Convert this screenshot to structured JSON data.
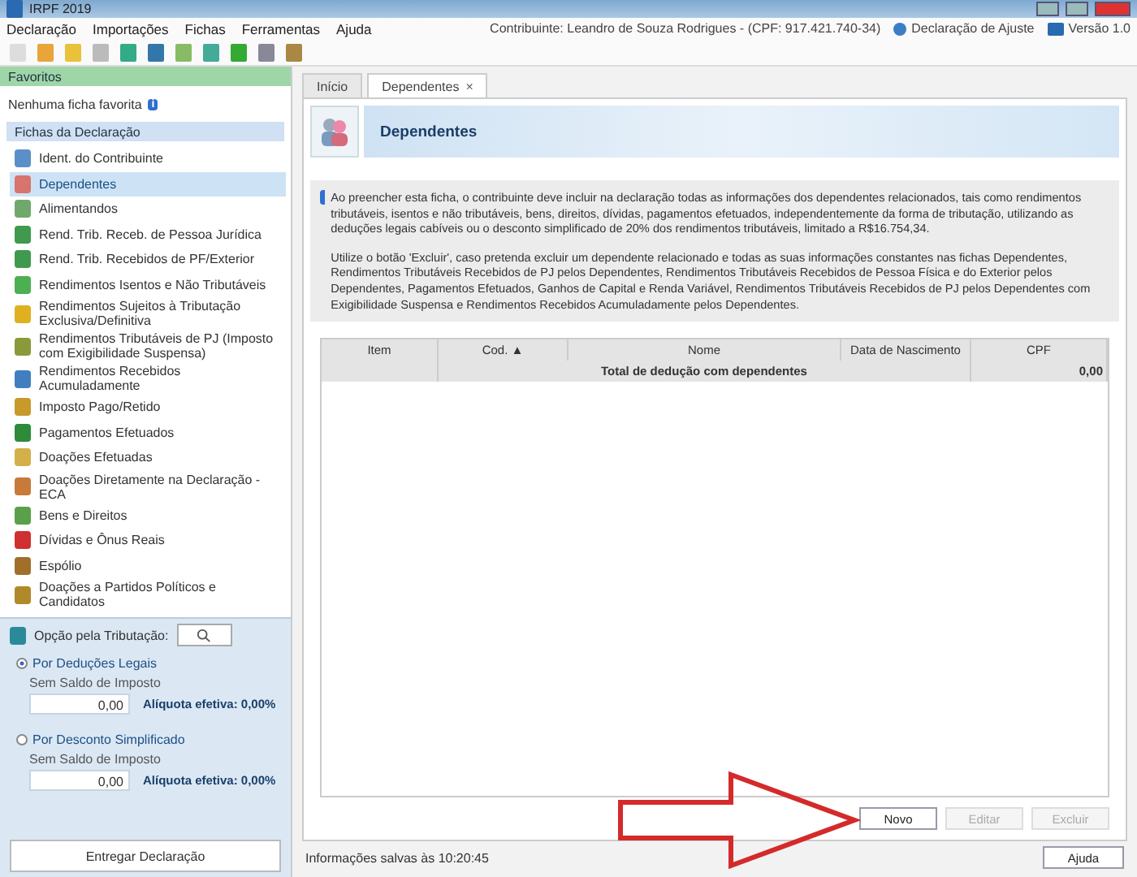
{
  "window": {
    "title": "IRPF 2019"
  },
  "menu": [
    "Declaração",
    "Importações",
    "Fichas",
    "Ferramentas",
    "Ajuda"
  ],
  "status_top": {
    "taxpayer": "Contribuinte: Leandro de Souza Rodrigues - (CPF: 917.421.740-34)",
    "declaration": "Declaração de Ajuste",
    "version": "Versão 1.0"
  },
  "favorites": {
    "title": "Favoritos",
    "empty": "Nenhuma ficha favorita",
    "badge": "i"
  },
  "forms": {
    "title": "Fichas da Declaração",
    "items": [
      {
        "label": "Ident. do Contribuinte",
        "selected": false,
        "color": "#5b8fc9"
      },
      {
        "label": "Dependentes",
        "selected": true,
        "color": "#d9736d"
      },
      {
        "label": "Alimentandos",
        "selected": false,
        "color": "#6fa86a"
      },
      {
        "label": "Rend. Trib. Receb. de Pessoa Jurídica",
        "selected": false,
        "color": "#3f9a4e"
      },
      {
        "label": "Rend. Trib. Recebidos de PF/Exterior",
        "selected": false,
        "color": "#3f9a4e"
      },
      {
        "label": "Rendimentos Isentos e Não Tributáveis",
        "selected": false,
        "color": "#4caf50"
      },
      {
        "label": "Rendimentos Sujeitos à Tributação Exclusiva/Definitiva",
        "selected": false,
        "color": "#e0b020"
      },
      {
        "label": "Rendimentos Tributáveis de PJ (Imposto com Exigibilidade Suspensa)",
        "selected": false,
        "color": "#8a9a3a"
      },
      {
        "label": "Rendimentos Recebidos Acumuladamente",
        "selected": false,
        "color": "#3f7fbf"
      },
      {
        "label": "Imposto Pago/Retido",
        "selected": false,
        "color": "#c89a2a"
      },
      {
        "label": "Pagamentos Efetuados",
        "selected": false,
        "color": "#2e8b3a"
      },
      {
        "label": "Doações Efetuadas",
        "selected": false,
        "color": "#d4b04a"
      },
      {
        "label": "Doações Diretamente na Declaração - ECA",
        "selected": false,
        "color": "#c87a3a"
      },
      {
        "label": "Bens e Direitos",
        "selected": false,
        "color": "#5aa04a"
      },
      {
        "label": "Dívidas e Ônus Reais",
        "selected": false,
        "color": "#d03030"
      },
      {
        "label": "Espólio",
        "selected": false,
        "color": "#a0702a"
      },
      {
        "label": "Doações a Partidos Políticos e Candidatos",
        "selected": false,
        "color": "#b08a2a"
      }
    ]
  },
  "taxation": {
    "title": "Opção pela Tributação:",
    "options": [
      {
        "label": "Por Deduções Legais",
        "selected": true,
        "caption": "Sem Saldo de Imposto",
        "value": "0,00",
        "rate": "Alíquota efetiva: 0,00%"
      },
      {
        "label": "Por Desconto Simplificado",
        "selected": false,
        "caption": "Sem Saldo de Imposto",
        "value": "0,00",
        "rate": "Alíquota efetiva: 0,00%"
      }
    ],
    "submit": "Entregar Declaração"
  },
  "tabs": [
    {
      "label": "Início",
      "selected": false,
      "closable": false
    },
    {
      "label": "Dependentes",
      "selected": true,
      "closable": true
    }
  ],
  "close_glyph": "×",
  "page": {
    "title": "Dependentes",
    "info": [
      "Ao preencher esta ficha, o contribuinte deve incluir na declaração todas as informações dos dependentes relacionados, tais como rendimentos tributáveis, isentos e não tributáveis, bens, direitos, dívidas, pagamentos efetuados, independentemente da forma de tributação, utilizando as deduções legais cabíveis ou o desconto simplificado de 20% dos rendimentos tributáveis, limitado a R$16.754,34.",
      "Utilize o botão 'Excluir', caso pretenda excluir um dependente relacionado e todas as suas informações constantes nas fichas Dependentes, Rendimentos Tributáveis Recebidos de PJ pelos Dependentes, Rendimentos Tributáveis Recebidos de Pessoa Física e do Exterior pelos Dependentes, Pagamentos Efetuados, Ganhos de Capital e Renda Variável, Rendimentos Tributáveis Recebidos de PJ pelos Dependentes com Exigibilidade Suspensa e Rendimentos Recebidos Acumuladamente pelos Dependentes."
    ],
    "table": {
      "columns": [
        "Item",
        "Cod. ▲",
        "Nome",
        "Data de Nascimento",
        "CPF"
      ],
      "total_label": "Total de dedução com dependentes",
      "total_value": "0,00"
    },
    "buttons": [
      {
        "label": "Novo",
        "disabled": false
      },
      {
        "label": "Editar",
        "disabled": true
      },
      {
        "label": "Excluir",
        "disabled": true
      }
    ]
  },
  "status_bar": {
    "message": "Informações salvas às 10:20:45",
    "help": "Ajuda"
  }
}
